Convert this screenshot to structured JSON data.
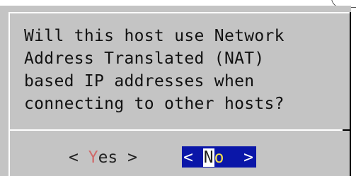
{
  "dialog": {
    "message": "Will this host use Network\nAddress Translated (NAT)\nbased IP addresses when\nconnecting to other hosts?"
  },
  "buttons": {
    "yes": {
      "left_bracket": "< ",
      "hotkey": "Y",
      "rest": "es",
      "right_bracket": " >"
    },
    "no": {
      "left_bracket": "< ",
      "hotkey": "N",
      "rest": "o",
      "right_bracket": "  >"
    }
  },
  "colors": {
    "dialog_background": "#c4c4c4",
    "selected_button_background": "#0a16a8",
    "hotkey_yes": "#d06a6a",
    "hotkey_no_rest": "#f7e24a"
  }
}
